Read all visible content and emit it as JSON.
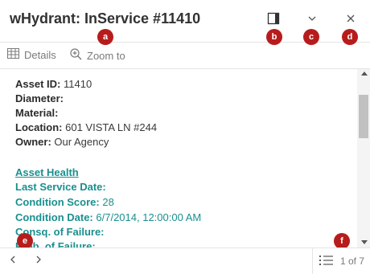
{
  "header": {
    "title": "wHydrant: InService #11410"
  },
  "badges": {
    "a": "a",
    "b": "b",
    "c": "c",
    "d": "d",
    "e": "e",
    "f": "f"
  },
  "toolbar": {
    "details_label": "Details",
    "zoom_label": "Zoom to"
  },
  "attributes": {
    "asset_id": {
      "label": "Asset ID:",
      "value": "11410"
    },
    "diameter": {
      "label": "Diameter:",
      "value": ""
    },
    "material": {
      "label": "Material:",
      "value": ""
    },
    "location": {
      "label": "Location:",
      "value": "601 VISTA LN #244"
    },
    "owner": {
      "label": "Owner:",
      "value": "Our Agency"
    }
  },
  "asset_health": {
    "link_label": "Asset Health",
    "last_service": {
      "label": "Last Service Date:",
      "value": ""
    },
    "condition_score": {
      "label": "Condition Score:",
      "value": "28"
    },
    "condition_date": {
      "label": "Condition Date:",
      "value": "6/7/2014, 12:00:00 AM"
    },
    "consq_failure": {
      "label": "Consq. of Failure:",
      "value": ""
    },
    "prob_failure": {
      "label": "Prob. of Failure:",
      "value": ""
    }
  },
  "footer": {
    "pager_text": "1 of 7"
  },
  "colors": {
    "accent_teal": "#1a8f8f",
    "badge_red": "#b71c1c",
    "border": "#e4e4e4"
  },
  "icons": {
    "dock": "dock-icon",
    "collapse": "chevron-down-icon",
    "close": "close-icon",
    "details": "table-icon",
    "zoom": "zoom-in-icon",
    "prev": "chevron-left-icon",
    "next": "chevron-right-icon",
    "list": "list-icon"
  }
}
